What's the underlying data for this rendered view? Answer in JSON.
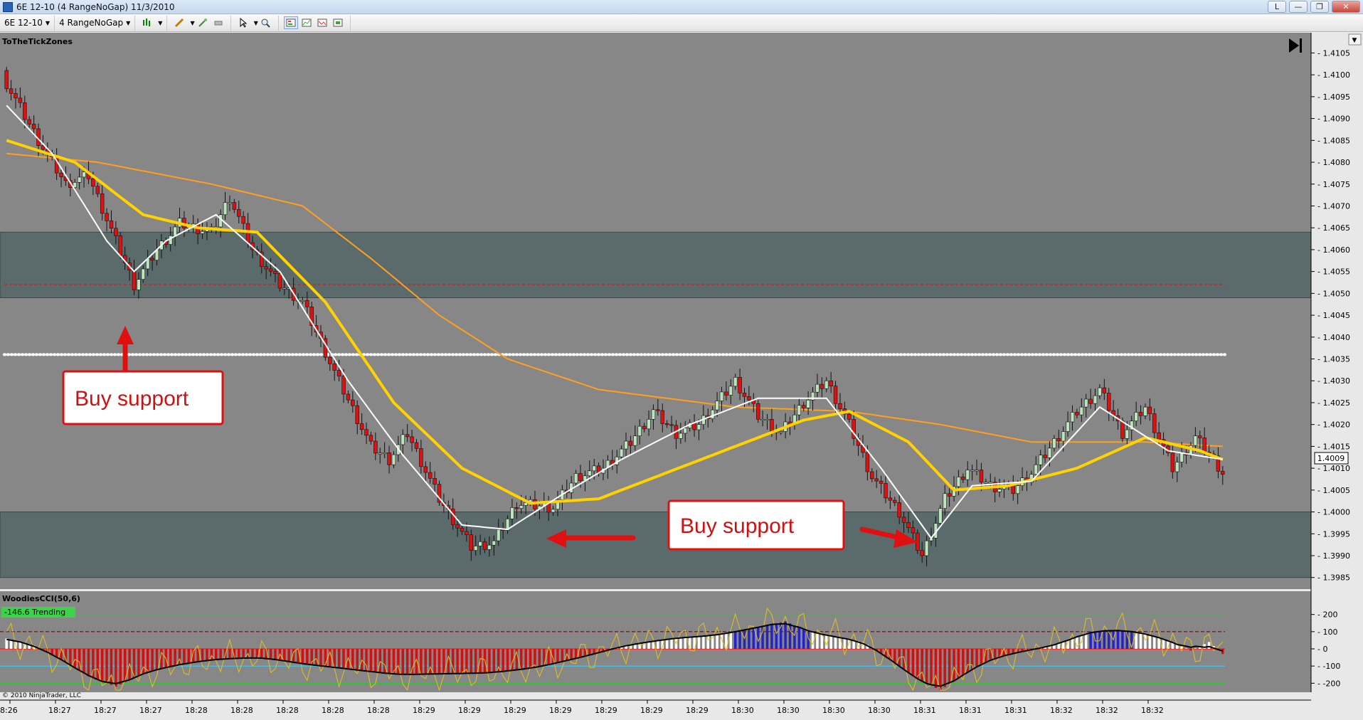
{
  "window": {
    "title": "6E 12-10 (4 RangeNoGap)  11/3/2010",
    "buttons": {
      "l": "L",
      "minimize": "—",
      "restore": "❐",
      "close": "✕"
    }
  },
  "toolbar": {
    "instrument": "6E 12-10",
    "period": "4 RangeNoGap"
  },
  "chart": {
    "indicator_label": "ToTheTickZones",
    "copyright": "© 2010 NinjaTrader, LLC",
    "current_price_label": "1.4009",
    "annotations": [
      "Buy support",
      "Buy support"
    ],
    "colors": {
      "background": "#878787",
      "zone_fill": "#5b6b6b",
      "up_candle": "#bde5bd",
      "down_candle": "#e01010",
      "fast_ma": "#ffffff",
      "mid_ma": "#ffd200",
      "slow_ma": "#ffa020",
      "callout_border": "#e01010",
      "callout_text": "#d01010"
    }
  },
  "chart_data": [
    {
      "type": "candlestick",
      "title": "ToTheTickZones",
      "ylim": [
        1.3983,
        1.4108
      ],
      "y_ticks": [
        "1.4105",
        "1.4100",
        "1.4095",
        "1.4090",
        "1.4085",
        "1.4080",
        "1.4075",
        "1.4070",
        "1.4065",
        "1.4060",
        "1.4055",
        "1.4050",
        "1.4045",
        "1.4040",
        "1.4035",
        "1.4030",
        "1.4025",
        "1.4020",
        "1.4015",
        "1.4010",
        "1.4005",
        "1.4000",
        "1.3995",
        "1.3990",
        "1.3985"
      ],
      "x_ticks": [
        "8:26",
        "18:27",
        "18:27",
        "18:27",
        "18:28",
        "18:28",
        "18:28",
        "18:28",
        "18:28",
        "18:29",
        "18:29",
        "18:29",
        "18:29",
        "18:29",
        "18:29",
        "18:29",
        "18:30",
        "18:30",
        "18:30",
        "18:30",
        "18:31",
        "18:31",
        "18:31",
        "18:32",
        "18:32",
        "18:32"
      ],
      "zones": [
        {
          "from": 1.4049,
          "to": 1.4064,
          "midline": 1.4052
        },
        {
          "from": 1.3985,
          "to": 1.4
        }
      ],
      "dotted_level": 1.4036,
      "last_price": 1.4009,
      "close_path": [
        [
          0,
          1.4098
        ],
        [
          7,
          1.4085
        ],
        [
          13,
          1.4075
        ],
        [
          18,
          1.4077
        ],
        [
          24,
          1.4062
        ],
        [
          28,
          1.4052
        ],
        [
          33,
          1.406
        ],
        [
          38,
          1.4066
        ],
        [
          45,
          1.4064
        ],
        [
          49,
          1.4072
        ],
        [
          54,
          1.406
        ],
        [
          60,
          1.4052
        ],
        [
          65,
          1.4048
        ],
        [
          72,
          1.4032
        ],
        [
          80,
          1.4015
        ],
        [
          84,
          1.4012
        ],
        [
          88,
          1.4018
        ],
        [
          95,
          1.4003
        ],
        [
          102,
          1.3992
        ],
        [
          107,
          1.3993
        ],
        [
          112,
          1.4002
        ],
        [
          120,
          1.4001
        ],
        [
          125,
          1.4008
        ],
        [
          131,
          1.401
        ],
        [
          137,
          1.4016
        ],
        [
          142,
          1.4023
        ],
        [
          147,
          1.4018
        ],
        [
          152,
          1.402
        ],
        [
          160,
          1.403
        ],
        [
          165,
          1.4022
        ],
        [
          170,
          1.4018
        ],
        [
          175,
          1.4025
        ],
        [
          180,
          1.403
        ],
        [
          185,
          1.402
        ],
        [
          190,
          1.4008
        ],
        [
          196,
          1.4
        ],
        [
          201,
          1.399
        ],
        [
          206,
          1.4003
        ],
        [
          211,
          1.401
        ],
        [
          216,
          1.4006
        ],
        [
          221,
          1.4005
        ],
        [
          225,
          1.4009
        ],
        [
          230,
          1.4016
        ],
        [
          235,
          1.4023
        ],
        [
          240,
          1.4028
        ],
        [
          245,
          1.4018
        ],
        [
          250,
          1.4024
        ],
        [
          256,
          1.401
        ],
        [
          261,
          1.4017
        ],
        [
          265,
          1.4012
        ],
        [
          267,
          1.4009
        ]
      ],
      "moving_averages": [
        {
          "name": "fast",
          "points": [
            [
              0,
              1.4093
            ],
            [
              10,
              1.4082
            ],
            [
              22,
              1.4062
            ],
            [
              28,
              1.4055
            ],
            [
              35,
              1.4062
            ],
            [
              46,
              1.4068
            ],
            [
              60,
              1.4055
            ],
            [
              75,
              1.403
            ],
            [
              87,
              1.4013
            ],
            [
              100,
              1.3997
            ],
            [
              110,
              1.3996
            ],
            [
              122,
              1.4004
            ],
            [
              135,
              1.4012
            ],
            [
              150,
              1.402
            ],
            [
              165,
              1.4026
            ],
            [
              180,
              1.4026
            ],
            [
              192,
              1.401
            ],
            [
              203,
              1.3994
            ],
            [
              212,
              1.4006
            ],
            [
              225,
              1.4007
            ],
            [
              240,
              1.4024
            ],
            [
              255,
              1.4014
            ],
            [
              267,
              1.4012
            ]
          ]
        },
        {
          "name": "mid",
          "points": [
            [
              0,
              1.4085
            ],
            [
              15,
              1.408
            ],
            [
              30,
              1.4068
            ],
            [
              42,
              1.4065
            ],
            [
              55,
              1.4064
            ],
            [
              70,
              1.4048
            ],
            [
              85,
              1.4025
            ],
            [
              100,
              1.401
            ],
            [
              115,
              1.4002
            ],
            [
              130,
              1.4003
            ],
            [
              145,
              1.4009
            ],
            [
              160,
              1.4015
            ],
            [
              175,
              1.4021
            ],
            [
              185,
              1.4023
            ],
            [
              198,
              1.4016
            ],
            [
              208,
              1.4005
            ],
            [
              220,
              1.4006
            ],
            [
              235,
              1.401
            ],
            [
              250,
              1.4017
            ],
            [
              262,
              1.4014
            ],
            [
              267,
              1.4012
            ]
          ]
        },
        {
          "name": "slow",
          "points": [
            [
              0,
              1.4082
            ],
            [
              20,
              1.408
            ],
            [
              45,
              1.4075
            ],
            [
              65,
              1.407
            ],
            [
              80,
              1.4058
            ],
            [
              95,
              1.4045
            ],
            [
              110,
              1.4035
            ],
            [
              130,
              1.4028
            ],
            [
              160,
              1.4024
            ],
            [
              185,
              1.4023
            ],
            [
              205,
              1.402
            ],
            [
              225,
              1.4016
            ],
            [
              250,
              1.4016
            ],
            [
              267,
              1.4015
            ]
          ]
        }
      ]
    },
    {
      "type": "bar",
      "title": "WoodiesCCI(50,6)",
      "badge": "-146.6 Trending",
      "ylim": [
        -240,
        240
      ],
      "y_ticks": [
        "200",
        "100",
        "0",
        "-100",
        "-200"
      ],
      "levels": [
        200,
        100,
        0,
        -100,
        -200
      ],
      "cci_path": [
        [
          0,
          60
        ],
        [
          6,
          20
        ],
        [
          12,
          -60
        ],
        [
          18,
          -160
        ],
        [
          24,
          -220
        ],
        [
          30,
          -140
        ],
        [
          38,
          -90
        ],
        [
          46,
          -60
        ],
        [
          56,
          -50
        ],
        [
          66,
          -90
        ],
        [
          76,
          -120
        ],
        [
          86,
          -150
        ],
        [
          96,
          -145
        ],
        [
          106,
          -140
        ],
        [
          116,
          -110
        ],
        [
          126,
          -50
        ],
        [
          136,
          20
        ],
        [
          146,
          60
        ],
        [
          156,
          80
        ],
        [
          166,
          130
        ],
        [
          171,
          160
        ],
        [
          176,
          100
        ],
        [
          182,
          70
        ],
        [
          188,
          40
        ],
        [
          194,
          -60
        ],
        [
          200,
          -180
        ],
        [
          205,
          -240
        ],
        [
          210,
          -150
        ],
        [
          216,
          -60
        ],
        [
          222,
          -20
        ],
        [
          230,
          20
        ],
        [
          238,
          100
        ],
        [
          244,
          110
        ],
        [
          250,
          90
        ],
        [
          256,
          40
        ],
        [
          260,
          -10
        ],
        [
          264,
          40
        ],
        [
          267,
          -30
        ]
      ]
    }
  ]
}
